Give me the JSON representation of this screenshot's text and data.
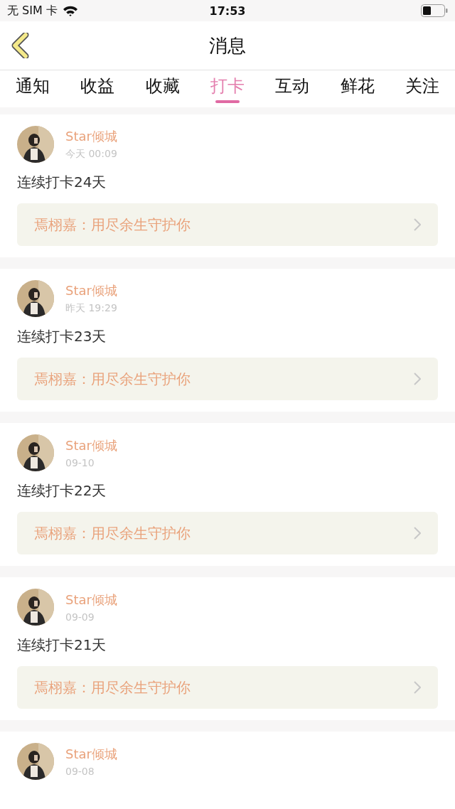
{
  "status_bar": {
    "carrier": "无 SIM 卡",
    "time": "17:53"
  },
  "nav": {
    "title": "消息"
  },
  "tabs": [
    {
      "label": "通知",
      "selected": false
    },
    {
      "label": "收益",
      "selected": false
    },
    {
      "label": "收藏",
      "selected": false
    },
    {
      "label": "打卡",
      "selected": true
    },
    {
      "label": "互动",
      "selected": false
    },
    {
      "label": "鲜花",
      "selected": false
    },
    {
      "label": "关注",
      "selected": false
    }
  ],
  "messages": [
    {
      "user": "Star倾城",
      "time": "今天 00:09",
      "text": "连续打卡24天",
      "quote": "焉栩嘉：用尽余生守护你"
    },
    {
      "user": "Star倾城",
      "time": "昨天 19:29",
      "text": "连续打卡23天",
      "quote": "焉栩嘉：用尽余生守护你"
    },
    {
      "user": "Star倾城",
      "time": "09-10",
      "text": "连续打卡22天",
      "quote": "焉栩嘉：用尽余生守护你"
    },
    {
      "user": "Star倾城",
      "time": "09-09",
      "text": "连续打卡21天",
      "quote": "焉栩嘉：用尽余生守护你"
    },
    {
      "user": "Star倾城",
      "time": "09-08"
    }
  ]
}
